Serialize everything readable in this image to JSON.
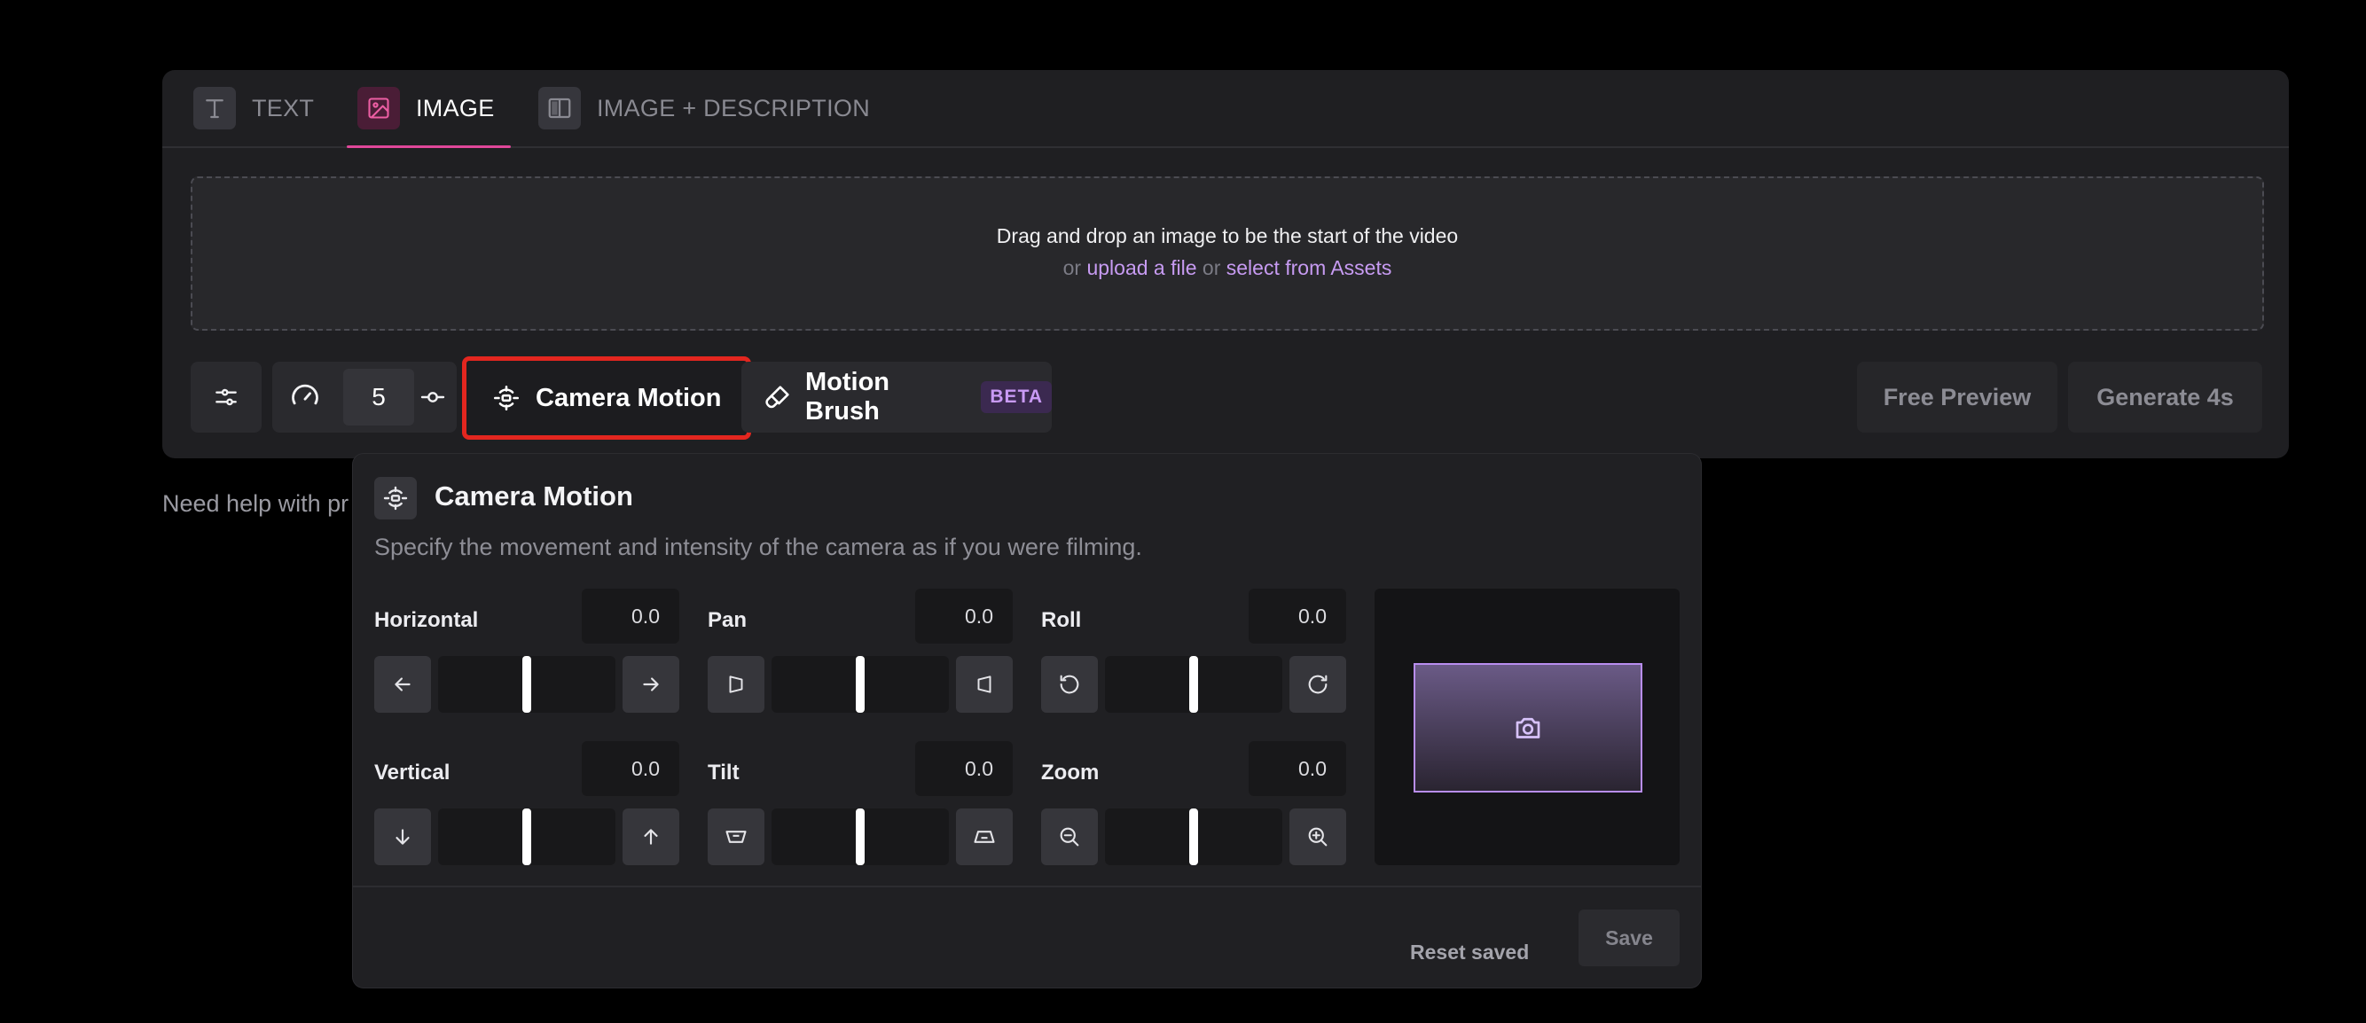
{
  "tabs": [
    {
      "label": "TEXT",
      "icon": "text-icon"
    },
    {
      "label": "IMAGE",
      "icon": "image-icon",
      "active": true
    },
    {
      "label": "IMAGE + DESCRIPTION",
      "icon": "split-layout-icon"
    }
  ],
  "dropzone": {
    "line1": "Drag and drop an image to be the start of the video",
    "or1": "or",
    "upload_link": "upload a file",
    "or2": "or",
    "assets_link": "select from Assets"
  },
  "toolbar": {
    "settings_icon": "sliders-icon",
    "speed_icon": "gauge-icon",
    "duration_value": "5",
    "commit_icon": "commit-icon",
    "camera_motion_label": "Camera Motion",
    "motion_brush_label": "Motion Brush",
    "beta_badge": "BETA",
    "free_preview_label": "Free Preview",
    "generate_label": "Generate 4s",
    "highlight_color": "#e3261f"
  },
  "help_text": "Need help with pr",
  "camera_motion": {
    "title": "Camera Motion",
    "description": "Specify the movement and intensity of the camera as if you were filming.",
    "controls": {
      "horizontal": {
        "label": "Horizontal",
        "value": "0.0",
        "level": 0.5,
        "left_icon": "arrow-left-icon",
        "right_icon": "arrow-right-icon"
      },
      "pan": {
        "label": "Pan",
        "value": "0.0",
        "level": 0.5,
        "left_icon": "pan-left-icon",
        "right_icon": "pan-right-icon"
      },
      "roll": {
        "label": "Roll",
        "value": "0.0",
        "level": 0.5,
        "left_icon": "rotate-ccw-icon",
        "right_icon": "rotate-cw-icon"
      },
      "vertical": {
        "label": "Vertical",
        "value": "0.0",
        "level": 0.5,
        "left_icon": "arrow-down-icon",
        "right_icon": "arrow-up-icon"
      },
      "tilt": {
        "label": "Tilt",
        "value": "0.0",
        "level": 0.5,
        "left_icon": "tilt-down-icon",
        "right_icon": "tilt-up-icon"
      },
      "zoom": {
        "label": "Zoom",
        "value": "0.0",
        "level": 0.5,
        "left_icon": "zoom-out-icon",
        "right_icon": "zoom-in-icon"
      }
    },
    "preview_icon": "camera-icon",
    "reset_label": "Reset saved",
    "save_label": "Save",
    "accent_color": "#b98ef0"
  }
}
